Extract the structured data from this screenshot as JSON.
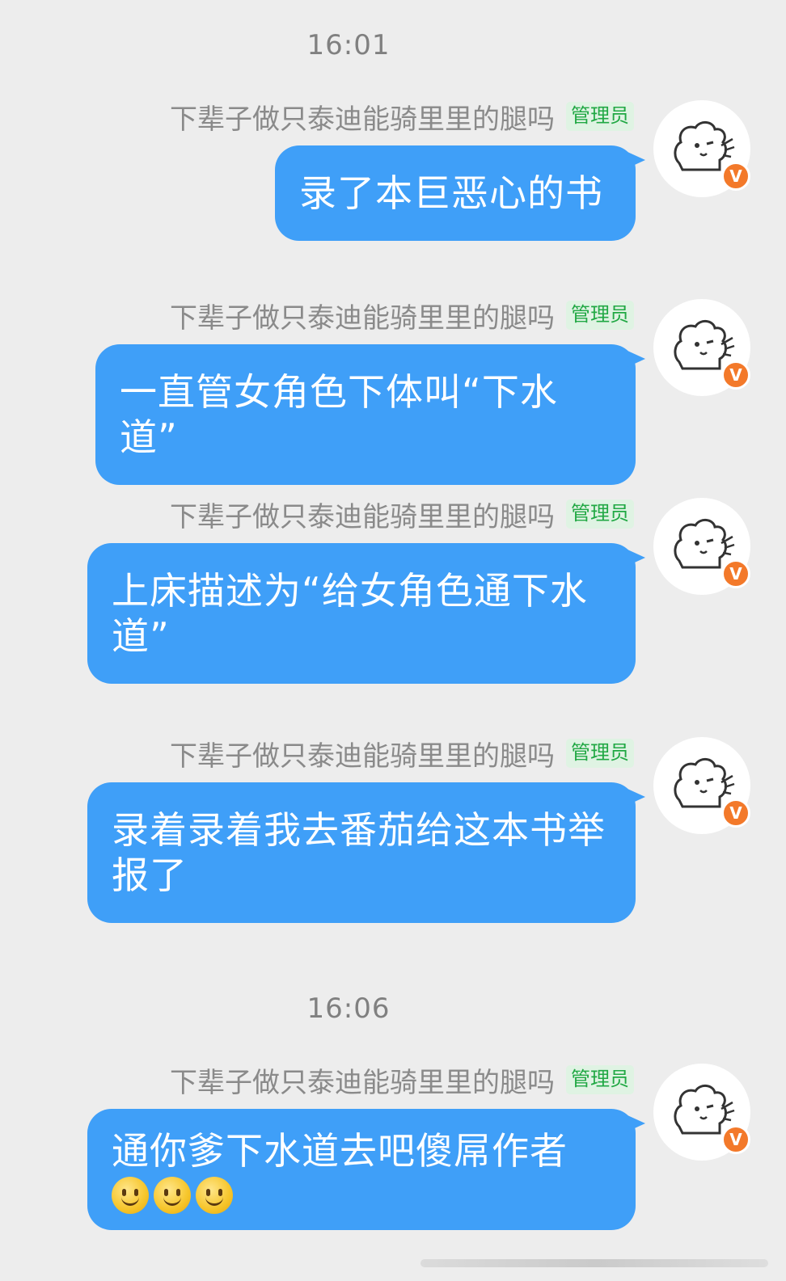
{
  "timestamps": [
    "16:01",
    "16:06"
  ],
  "sender": {
    "name": "下辈子做只泰迪能骑里里的腿吗",
    "role": "管理员",
    "avatar_icon": "dog-doodle-avatar-icon",
    "verified_badge": "V"
  },
  "messages": [
    {
      "text": "录了本巨恶心的书"
    },
    {
      "text": "一直管女角色下体叫“下水道”"
    },
    {
      "text": "上床描述为“给女角色通下水道”"
    },
    {
      "text": "录着录着我去番茄给这本书举报了"
    },
    {
      "text": "通你爹下水道去吧傻屌作者",
      "emoji": [
        "slight-smile-emoji",
        "slight-smile-emoji",
        "slight-smile-emoji"
      ]
    }
  ],
  "colors": {
    "background": "#ededed",
    "bubble": "#3f9ff8",
    "role_badge_text": "#21a844",
    "vip_badge": "#f3792a"
  }
}
